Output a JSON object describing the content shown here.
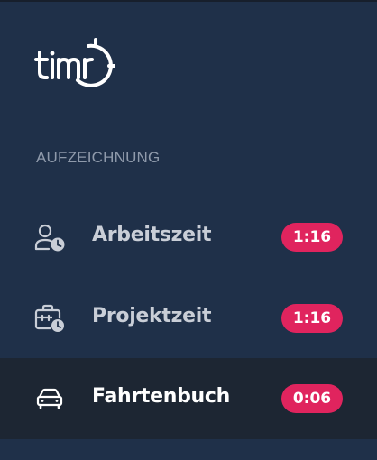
{
  "brand": {
    "logo_text": "timr",
    "logo_icon": "timr-logo-clock"
  },
  "colors": {
    "sidebar_bg": "#1f3049",
    "active_item_bg": "#1d2633",
    "badge_bg": "#e0245e",
    "section_title": "#8f9aab",
    "item_label": "#c9ced7",
    "active_label": "#ffffff"
  },
  "sidebar": {
    "section_title": "AUFZEICHNUNG",
    "items": [
      {
        "label": "Arbeitszeit",
        "badge": "1:16",
        "icon": "user-clock-icon",
        "active": false
      },
      {
        "label": "Projektzeit",
        "badge": "1:16",
        "icon": "briefcase-clock-icon",
        "active": false
      },
      {
        "label": "Fahrtenbuch",
        "badge": "0:06",
        "icon": "car-icon",
        "active": true
      }
    ]
  }
}
